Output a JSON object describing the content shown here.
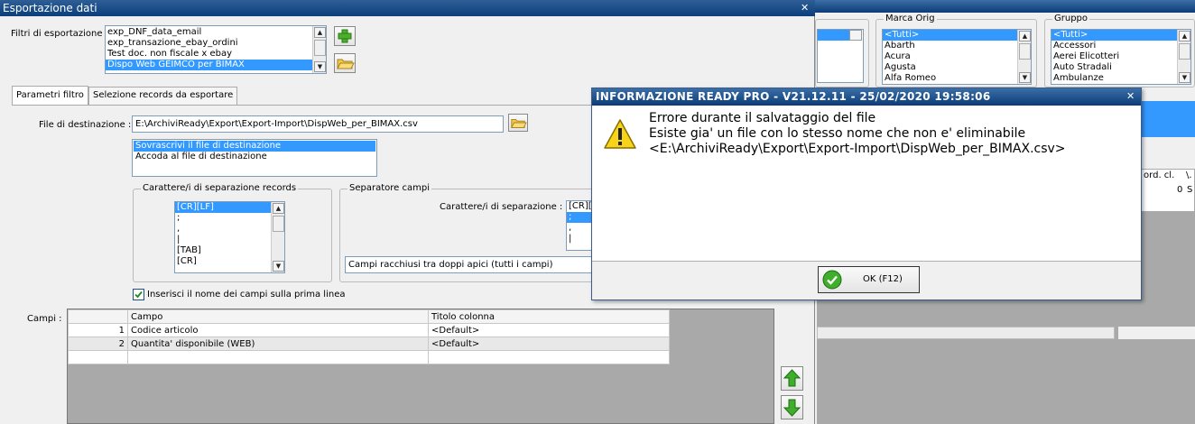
{
  "main_window": {
    "title": "Esportazione dati",
    "close_glyph": "✕",
    "filters_label": "Filtri di esportazione :",
    "filters": [
      {
        "label": "exp_DNF_data_email",
        "selected": false
      },
      {
        "label": "exp_transazione_ebay_ordini",
        "selected": false
      },
      {
        "label": "Test doc. non fiscale x ebay",
        "selected": false
      },
      {
        "label": "Dispo Web GEIMCO per BIMAX",
        "selected": true
      }
    ],
    "tabs": [
      {
        "label": "Parametri filtro",
        "active": true
      },
      {
        "label": "Selezione records da esportare",
        "active": false
      }
    ],
    "dest_file_label": "File di destinazione :",
    "dest_file_value": "E:\\ArchiviReady\\Export\\Export-Import\\DispWeb_per_BIMAX.csv",
    "write_mode_options": [
      {
        "label": "Sovrascrivi il file di destinazione",
        "selected": true
      },
      {
        "label": "Accoda al file di destinazione",
        "selected": false
      }
    ],
    "record_sep_group": "Carattere/i di separazione records",
    "record_sep_options": [
      {
        "label": "[CR][LF]",
        "selected": true
      },
      {
        "label": ";",
        "selected": false
      },
      {
        "label": ",",
        "selected": false
      },
      {
        "label": "|",
        "selected": false
      },
      {
        "label": "[TAB]",
        "selected": false
      },
      {
        "label": "[CR]",
        "selected": false
      }
    ],
    "field_sep_group": "Separatore campi",
    "field_sep_label": "Carattere/i di separazione :",
    "field_sep_options": [
      {
        "label": "[CR][",
        "selected": false
      },
      {
        "label": ";",
        "selected": true
      },
      {
        "label": ",",
        "selected": false
      },
      {
        "label": "|",
        "selected": false
      }
    ],
    "quote_mode_value": "Campi racchiusi tra doppi apici (tutti i campi)",
    "header_checkbox_label": "Inserisci il nome dei campi sulla prima linea",
    "header_checkbox_checked": true,
    "fields_label": "Campi :",
    "fields_table": {
      "headers": [
        "",
        "Campo",
        "Titolo colonna"
      ],
      "rows": [
        [
          "1",
          "Codice articolo",
          "<Default>"
        ],
        [
          "2",
          "Quantita' disponibile (WEB)",
          "<Default>"
        ]
      ]
    }
  },
  "background_window": {
    "marca_label": "Marca Orig",
    "marca_items": [
      {
        "label": "<Tutti>",
        "selected": true
      },
      {
        "label": "Abarth",
        "selected": false
      },
      {
        "label": "Acura",
        "selected": false
      },
      {
        "label": "Agusta",
        "selected": false
      },
      {
        "label": "Alfa Romeo",
        "selected": false
      }
    ],
    "gruppo_label": "Gruppo",
    "gruppo_items": [
      {
        "label": "<Tutti>",
        "selected": true
      },
      {
        "label": "Accessori",
        "selected": false
      },
      {
        "label": "Aerei Elicotteri",
        "selected": false
      },
      {
        "label": "Auto Stradali",
        "selected": false
      },
      {
        "label": "Ambulanze",
        "selected": false
      }
    ],
    "col_q_ord": "Q ord. cl.",
    "col_next": "\\.",
    "cell_q_ord": "0",
    "cell_next": "S"
  },
  "dialog": {
    "title": "INFORMAZIONE READY PRO - V21.12.11 - 25/02/2020 19:58:06",
    "close_glyph": "✕",
    "message_lines": [
      "Errore durante il salvataggio del file",
      "Esiste gia' un file con lo stesso nome che non e' eliminabile",
      "<E:\\ArchiviReady\\Export\\Export-Import\\DispWeb_per_BIMAX.csv>"
    ],
    "ok_label": "OK (F12)"
  },
  "colors": {
    "selection": "#3399ff",
    "title_bar": "#0a3f7c",
    "add_icon": "#4caf2b",
    "folder_icon": "#f2c84b",
    "arrow_icon": "#3fae2a",
    "warning_icon": "#f7d417"
  }
}
